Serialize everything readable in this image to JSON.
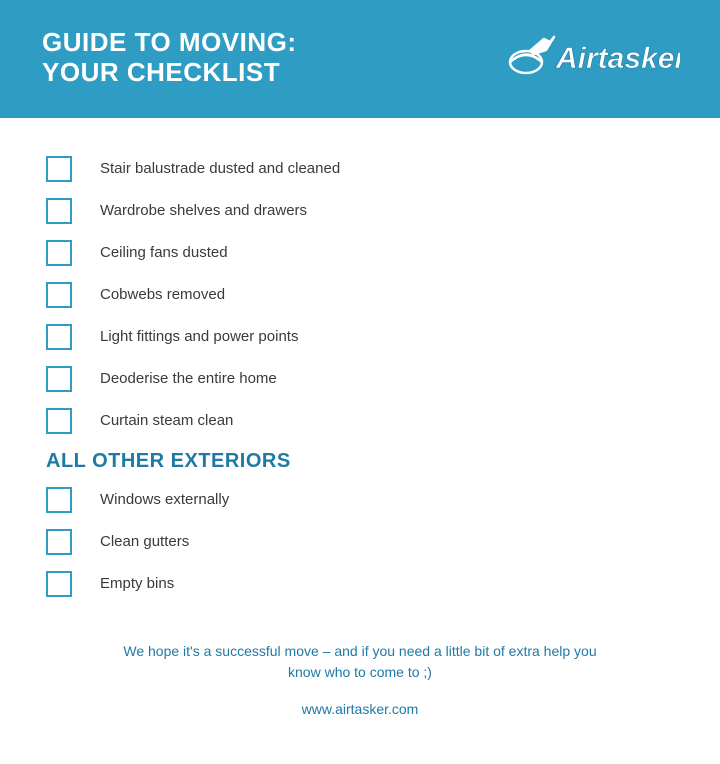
{
  "header": {
    "title_line1": "GUIDE TO MOVING:",
    "title_line2": "YOUR CHECKLIST",
    "brand": "Airtasker"
  },
  "sections": [
    {
      "heading": null,
      "items": [
        "Stair balustrade dusted and cleaned",
        "Wardrobe shelves and drawers",
        "Ceiling fans dusted",
        "Cobwebs removed",
        "Light fittings and power points",
        "Deoderise the entire home",
        "Curtain steam clean"
      ]
    },
    {
      "heading": "ALL OTHER EXTERIORS",
      "items": [
        "Windows externally",
        "Clean gutters",
        "Empty bins"
      ]
    }
  ],
  "footer": {
    "message": "We hope it's a successful move – and if you need a little bit of extra help you know who to come to ;)",
    "url": "www.airtasker.com"
  }
}
